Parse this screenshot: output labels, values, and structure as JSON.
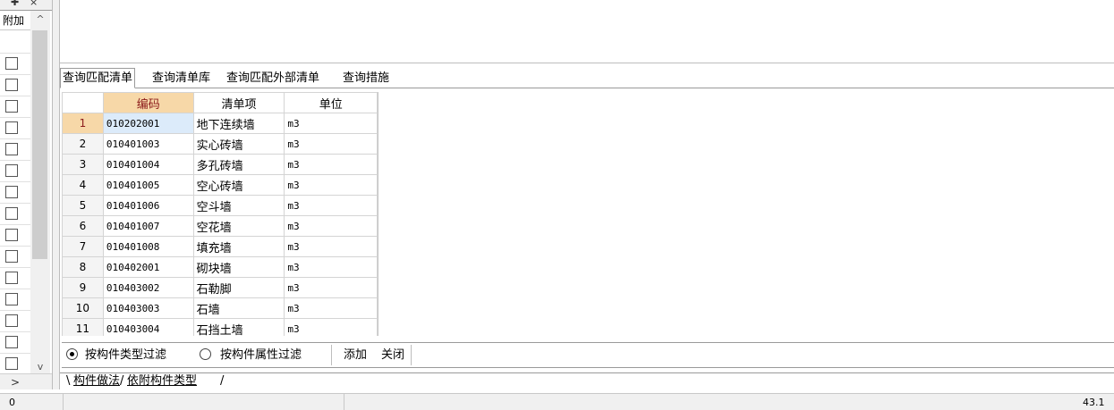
{
  "left_panel": {
    "pin_glyph": "✚",
    "close_glyph": "×",
    "header": "附加",
    "scroll_up": "^",
    "scroll_down": "v",
    "scroll_right": ">"
  },
  "tabs": [
    {
      "label": "查询匹配清单",
      "active": true
    },
    {
      "label": "查询清单库",
      "active": false
    },
    {
      "label": "查询匹配外部清单",
      "active": false
    },
    {
      "label": "查询措施",
      "active": false
    }
  ],
  "grid": {
    "columns": [
      "编码",
      "清单项",
      "单位"
    ],
    "rows": [
      {
        "n": "1",
        "code": "010202001",
        "name": "地下连续墙",
        "unit": "m3"
      },
      {
        "n": "2",
        "code": "010401003",
        "name": "实心砖墙",
        "unit": "m3"
      },
      {
        "n": "3",
        "code": "010401004",
        "name": "多孔砖墙",
        "unit": "m3"
      },
      {
        "n": "4",
        "code": "010401005",
        "name": "空心砖墙",
        "unit": "m3"
      },
      {
        "n": "5",
        "code": "010401006",
        "name": "空斗墙",
        "unit": "m3"
      },
      {
        "n": "6",
        "code": "010401007",
        "name": "空花墙",
        "unit": "m3"
      },
      {
        "n": "7",
        "code": "010401008",
        "name": "填充墙",
        "unit": "m3"
      },
      {
        "n": "8",
        "code": "010402001",
        "name": "砌块墙",
        "unit": "m3"
      },
      {
        "n": "9",
        "code": "010403002",
        "name": "石勒脚",
        "unit": "m3"
      },
      {
        "n": "10",
        "code": "010403003",
        "name": "石墙",
        "unit": "m3"
      },
      {
        "n": "11",
        "code": "010403004",
        "name": "石挡土墙",
        "unit": "m3"
      }
    ]
  },
  "filter": {
    "option_type": "按构件类型过滤",
    "option_attr": "按构件属性过滤",
    "add": "添加",
    "close": "关闭"
  },
  "bottom_tabs": {
    "method": "构件做法",
    "dependent": "依附构件类型"
  },
  "status": {
    "left": "0",
    "right": "43.1"
  }
}
